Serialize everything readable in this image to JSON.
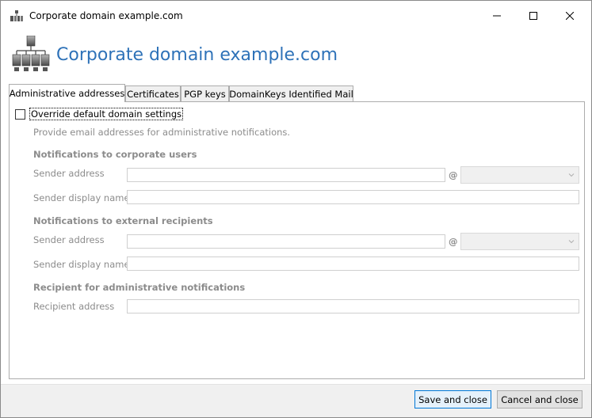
{
  "window": {
    "title": "Corporate domain example.com",
    "controls": {
      "minimize": "minimize",
      "maximize": "maximize",
      "close": "close"
    }
  },
  "header": {
    "title": "Corporate domain example.com",
    "icon": "domain-network-icon"
  },
  "tabs": [
    {
      "label": "Administrative addresses",
      "active": true
    },
    {
      "label": "Certificates",
      "active": false
    },
    {
      "label": "PGP keys",
      "active": false
    },
    {
      "label": "DomainKeys Identified Mail",
      "active": false
    }
  ],
  "override": {
    "label": "Override default domain settings",
    "checked": false
  },
  "description": "Provide email addresses for administrative notifications.",
  "corporate": {
    "heading": "Notifications to corporate users",
    "sender_address_label": "Sender address",
    "sender_address_value": "",
    "at_sign": "@",
    "domain_value": "",
    "display_name_label": "Sender display name",
    "display_name_value": ""
  },
  "external": {
    "heading": "Notifications to external recipients",
    "sender_address_label": "Sender address",
    "sender_address_value": "",
    "at_sign": "@",
    "domain_value": "",
    "display_name_label": "Sender display name",
    "display_name_value": ""
  },
  "recipient": {
    "heading": "Recipient for administrative notifications",
    "address_label": "Recipient address",
    "address_value": ""
  },
  "footer": {
    "save_label": "Save and close",
    "cancel_label": "Cancel and close"
  },
  "colors": {
    "accent": "#2e72b8",
    "disabled_text": "#8c8c8c",
    "default_button_border": "#0078d7"
  }
}
